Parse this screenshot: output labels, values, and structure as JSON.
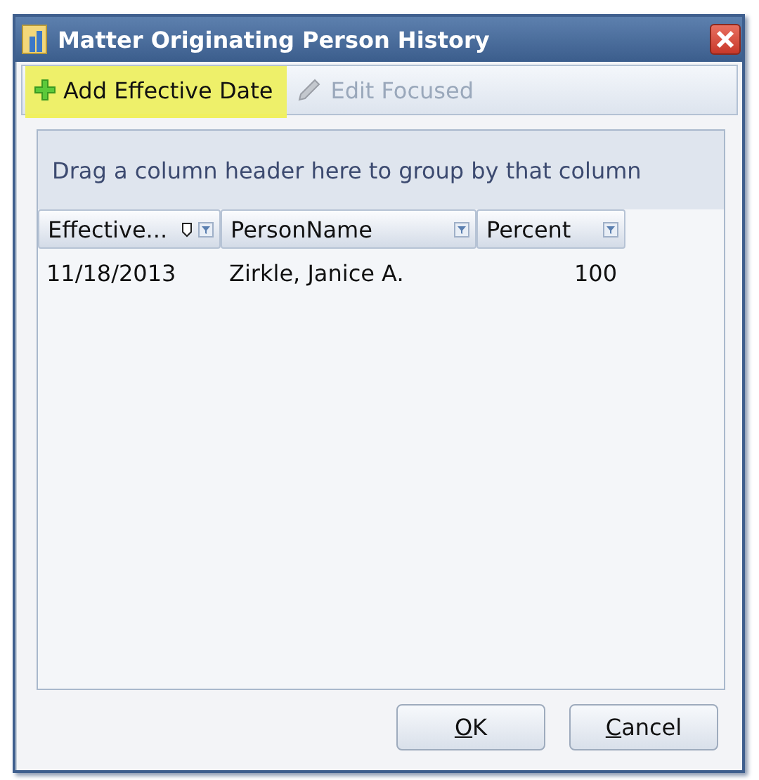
{
  "window": {
    "title": "Matter Originating Person History"
  },
  "toolbar": [
    {
      "kind": "add",
      "label": "Add Effective Date",
      "highlighted": true,
      "disabled": false
    },
    {
      "kind": "edit",
      "label": "Edit Focused",
      "highlighted": false,
      "disabled": true
    }
  ],
  "grid": {
    "group_panel": "Drag a column header here to group by that column",
    "columns": [
      {
        "label": "Effective...",
        "kind": "text",
        "sorted": true
      },
      {
        "label": "PersonName",
        "kind": "text",
        "sorted": false
      },
      {
        "label": "Percent",
        "kind": "number",
        "sorted": false
      }
    ],
    "rows": [
      [
        "11/18/2013",
        "Zirkle, Janice A.",
        "100"
      ]
    ]
  },
  "buttons": [
    {
      "label": "OK",
      "mnemonic_underlined": true
    },
    {
      "label": "Cancel",
      "mnemonic_underlined": true
    }
  ]
}
